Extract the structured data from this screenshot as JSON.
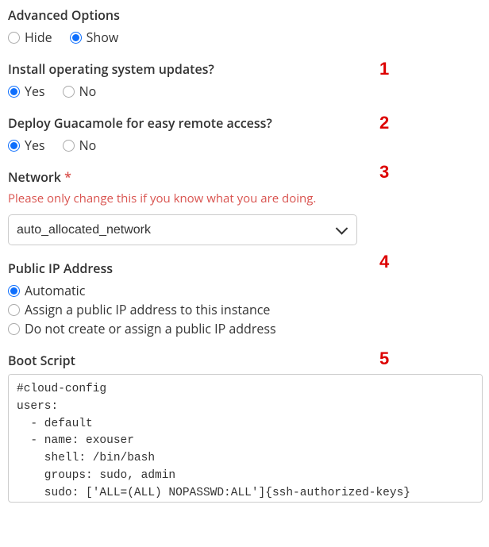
{
  "advanced": {
    "title": "Advanced Options",
    "hide": "Hide",
    "show": "Show"
  },
  "updates": {
    "title": "Install operating system updates?",
    "yes": "Yes",
    "no": "No"
  },
  "guac": {
    "title": "Deploy Guacamole for easy remote access?",
    "yes": "Yes",
    "no": "No"
  },
  "network": {
    "title": "Network ",
    "required_mark": "*",
    "warning": "Please only change this if you know what you are doing.",
    "selected": "auto_allocated_network"
  },
  "publicip": {
    "title": "Public IP Address",
    "auto": "Automatic",
    "assign": "Assign a public IP address to this instance",
    "none": "Do not create or assign a public IP address"
  },
  "boot": {
    "title": "Boot Script",
    "content": "#cloud-config\nusers:\n  - default\n  - name: exouser\n    shell: /bin/bash\n    groups: sudo, admin\n    sudo: ['ALL=(ALL) NOPASSWD:ALL']{ssh-authorized-keys}"
  },
  "annotations": {
    "n1": "1",
    "n2": "2",
    "n3": "3",
    "n4": "4",
    "n5": "5"
  }
}
